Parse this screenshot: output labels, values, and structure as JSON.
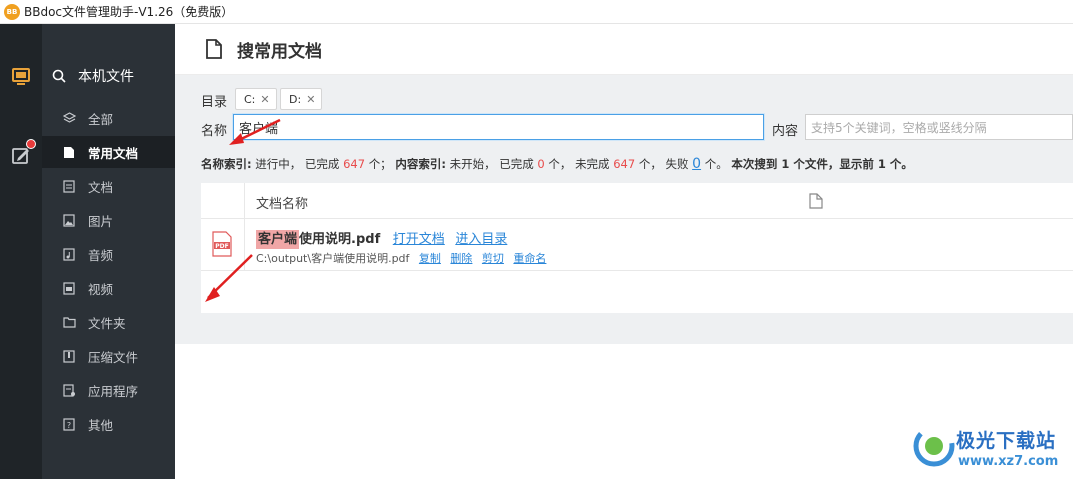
{
  "window": {
    "app_logo_text": "BB",
    "title": "BBdoc文件管理助手-V1.26（免费版）"
  },
  "sidebar": {
    "header": "本机文件",
    "items": [
      {
        "label": "全部",
        "icon": "layers-icon"
      },
      {
        "label": "常用文档",
        "icon": "document-icon",
        "active": true
      },
      {
        "label": "文档",
        "icon": "text-file-icon"
      },
      {
        "label": "图片",
        "icon": "image-icon"
      },
      {
        "label": "音频",
        "icon": "audio-icon"
      },
      {
        "label": "视频",
        "icon": "video-icon"
      },
      {
        "label": "文件夹",
        "icon": "folder-icon"
      },
      {
        "label": "压缩文件",
        "icon": "archive-icon"
      },
      {
        "label": "应用程序",
        "icon": "app-icon"
      },
      {
        "label": "其他",
        "icon": "other-icon"
      }
    ]
  },
  "main": {
    "title": "搜常用文档",
    "filter": {
      "dir_label": "目录",
      "dirs": [
        "C:",
        "D:"
      ],
      "name_label": "名称",
      "name_value": "客户端",
      "content_label": "内容",
      "content_placeholder": "支持5个关键词，空格或竖线分隔"
    },
    "status": {
      "name_index_label": "名称索引:",
      "name_state": "进行中，",
      "name_done_prefix": "已完成",
      "name_done_count": "647",
      "name_done_suffix": "个；",
      "content_index_label": "内容索引:",
      "content_state": "未开始，",
      "content_done_prefix": "已完成",
      "content_done_count": "0",
      "content_done_suffix": "个，",
      "undone_prefix": "未完成",
      "undone_count": "647",
      "undone_suffix": "个，",
      "failed_prefix": "失败",
      "failed_count": "0",
      "failed_suffix": "个。",
      "summary": "本次搜到 1 个文件，显示前 1 个。"
    },
    "table": {
      "header_name": "文档名称",
      "rows": [
        {
          "file_icon_label": "PDF",
          "name_highlight": "客户端",
          "name_rest": "使用说明.pdf",
          "open_link": "打开文档",
          "dir_link": "进入目录",
          "path": "C:\\output\\客户端使用说明.pdf",
          "actions": [
            "复制",
            "删除",
            "剪切",
            "重命名"
          ]
        }
      ]
    }
  },
  "watermark": {
    "cn": "极光下载站",
    "url": "www.xz7.com"
  },
  "colors": {
    "accent": "#2a86d8",
    "highlight": "#f0a6a6",
    "count_red": "#e84c4c",
    "sidebar_bg": "#2b3137",
    "arrow_red": "#e02020"
  }
}
